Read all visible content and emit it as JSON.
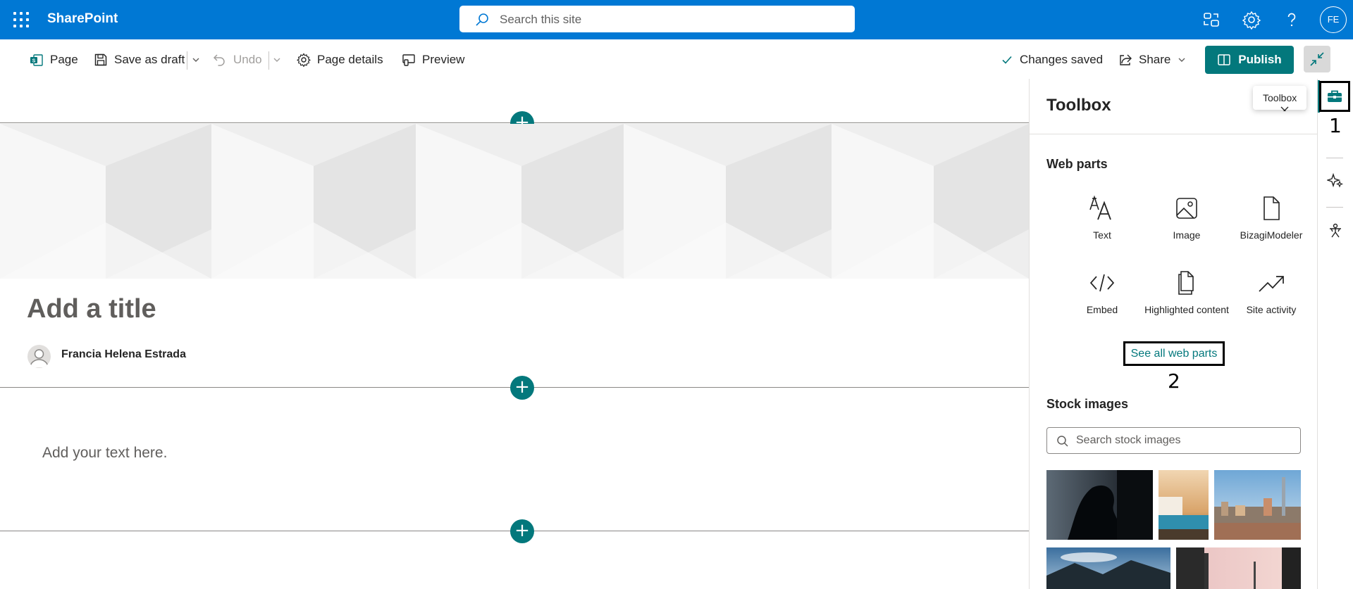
{
  "suite_bar": {
    "brand": "SharePoint",
    "search_placeholder": "Search this site",
    "avatar_initials": "FE",
    "color": "#0078d4"
  },
  "command_bar": {
    "page_label": "Page",
    "save_draft_label": "Save as draft",
    "undo_label": "Undo",
    "page_details_label": "Page details",
    "preview_label": "Preview",
    "status_label": "Changes saved",
    "share_label": "Share",
    "publish_label": "Publish",
    "publish_color": "#03787c"
  },
  "canvas": {
    "title_placeholder": "Add a title",
    "author_name": "Francia Helena Estrada",
    "text_placeholder": "Add your text here."
  },
  "toolbox": {
    "title": "Toolbox",
    "tooltip": "Toolbox",
    "web_parts_heading": "Web parts",
    "web_parts": [
      {
        "label": "Text",
        "icon": "text-icon"
      },
      {
        "label": "Image",
        "icon": "image-icon"
      },
      {
        "label": "BizagiModeler",
        "icon": "document-icon"
      },
      {
        "label": "Embed",
        "icon": "code-icon"
      },
      {
        "label": "Highlighted content",
        "icon": "documents-icon"
      },
      {
        "label": "Site activity",
        "icon": "trend-icon"
      }
    ],
    "see_all_label": "See all web parts",
    "stock_images_heading": "Stock images",
    "stock_search_placeholder": "Search stock images"
  },
  "annotations": {
    "marker_1": "1",
    "marker_2": "2"
  },
  "accent_color": "#03787c"
}
